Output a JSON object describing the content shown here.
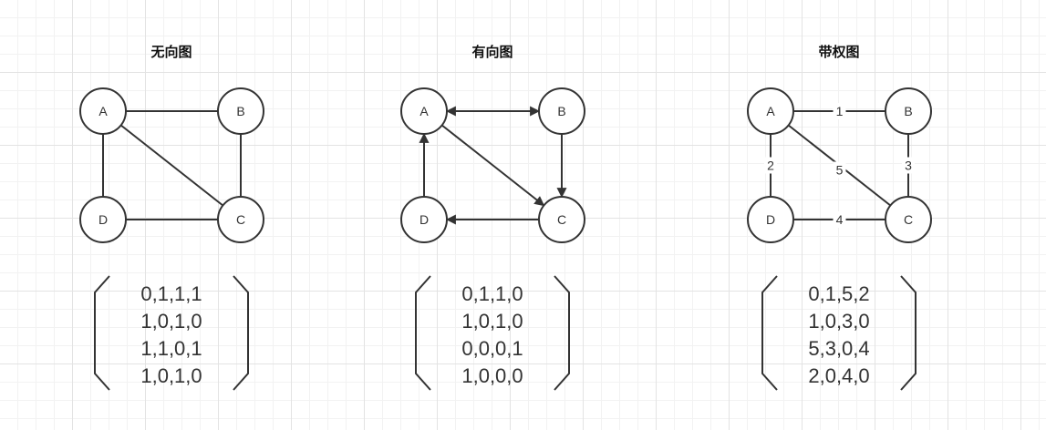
{
  "diagrams": [
    {
      "title": "无向图",
      "nodes": [
        "A",
        "B",
        "C",
        "D"
      ],
      "edges": [
        {
          "from": "A",
          "to": "B"
        },
        {
          "from": "A",
          "to": "C"
        },
        {
          "from": "A",
          "to": "D"
        },
        {
          "from": "B",
          "to": "C"
        },
        {
          "from": "D",
          "to": "C"
        }
      ],
      "matrix": [
        "0,1,1,1",
        "1,0,1,0",
        "1,1,0,1",
        "1,0,1,0"
      ]
    },
    {
      "title": "有向图",
      "nodes": [
        "A",
        "B",
        "C",
        "D"
      ],
      "edges": [
        {
          "from": "A",
          "to": "B",
          "bidirectional": true
        },
        {
          "from": "A",
          "to": "C"
        },
        {
          "from": "B",
          "to": "C"
        },
        {
          "from": "C",
          "to": "D"
        },
        {
          "from": "D",
          "to": "A"
        }
      ],
      "matrix": [
        "0,1,1,0",
        "1,0,1,0",
        "0,0,0,1",
        "1,0,0,0"
      ]
    },
    {
      "title": "带权图",
      "nodes": [
        "A",
        "B",
        "C",
        "D"
      ],
      "edges": [
        {
          "from": "A",
          "to": "B",
          "weight": "1"
        },
        {
          "from": "A",
          "to": "D",
          "weight": "2"
        },
        {
          "from": "B",
          "to": "C",
          "weight": "3"
        },
        {
          "from": "D",
          "to": "C",
          "weight": "4"
        },
        {
          "from": "A",
          "to": "C",
          "weight": "5"
        }
      ],
      "matrix": [
        "0,1,5,2",
        "1,0,3,0",
        "5,3,0,4",
        "2,0,4,0"
      ]
    }
  ]
}
